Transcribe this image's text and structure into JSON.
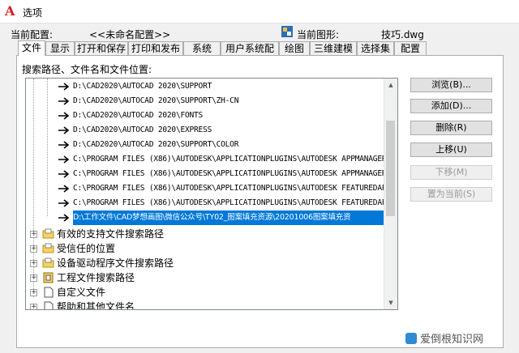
{
  "window": {
    "title": "选项"
  },
  "config": {
    "current_label": "当前配置:",
    "current_value": "<<未命名配置>>",
    "drawing_label": "当前图形:",
    "drawing_value": "技巧.dwg"
  },
  "tabs": [
    {
      "label": "文件",
      "active": true
    },
    {
      "label": "显示"
    },
    {
      "label": "打开和保存"
    },
    {
      "label": "打印和发布"
    },
    {
      "label": "系统"
    },
    {
      "label": "用户系统配置"
    },
    {
      "label": "绘图"
    },
    {
      "label": "三维建模"
    },
    {
      "label": "选择集"
    },
    {
      "label": "配置"
    }
  ],
  "files": {
    "section_label": "搜索路径、文件名和文件位置:",
    "paths": [
      "D:\\CAD2020\\AUTOCAD 2020\\SUPPORT",
      "D:\\CAD2020\\AUTOCAD 2020\\SUPPORT\\ZH-CN",
      "D:\\CAD2020\\AUTOCAD 2020\\FONTS",
      "D:\\CAD2020\\AUTOCAD 2020\\EXPRESS",
      "D:\\CAD2020\\AUTOCAD 2020\\SUPPORT\\COLOR",
      "C:\\PROGRAM FILES (X86)\\AUTODESK\\APPLICATIONPLUGINS\\AUTODESK APPMANAGER",
      "C:\\PROGRAM FILES (X86)\\AUTODESK\\APPLICATIONPLUGINS\\AUTODESK APPMANAGER",
      "C:\\PROGRAM FILES (X86)\\AUTODESK\\APPLICATIONPLUGINS\\AUTODESK FEATUREDAPP",
      "C:\\PROGRAM FILES (X86)\\AUTODESK\\APPLICATIONPLUGINS\\AUTODESK FEATUREDAPP",
      "D:\\工作文件\\CAD梦想画图\\微信公众号\\TY02_图案填充资源\\20201006图案填充资"
    ],
    "nodes": [
      "有效的支持文件搜索路径",
      "受信任的位置",
      "设备驱动程序文件搜索路径",
      "工程文件搜索路径",
      "自定义文件",
      "帮助和其他文件名"
    ]
  },
  "buttons": {
    "browse": "浏览(B)...",
    "add": "添加(D)...",
    "remove": "删除(R)",
    "move_up": "上移(U)",
    "move_down": "下移(M)",
    "set_current": "置为当前(S)"
  },
  "watermark": "爱倒根知识网"
}
